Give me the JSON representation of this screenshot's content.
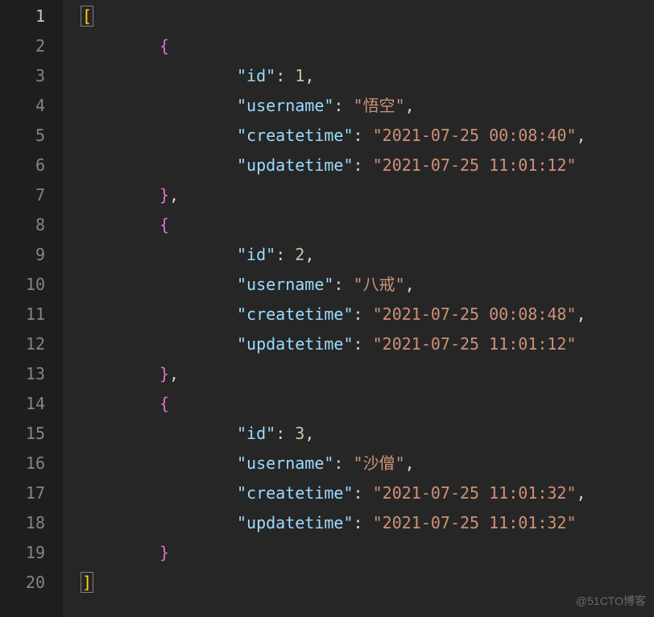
{
  "total_lines": 20,
  "active_line": 1,
  "watermark": "@51CTO博客",
  "json_content": [
    {
      "id": 1,
      "username": "悟空",
      "createtime": "2021-07-25 00:08:40",
      "updatetime": "2021-07-25 11:01:12"
    },
    {
      "id": 2,
      "username": "八戒",
      "createtime": "2021-07-25 00:08:48",
      "updatetime": "2021-07-25 11:01:12"
    },
    {
      "id": 3,
      "username": "沙僧",
      "createtime": "2021-07-25 11:01:32",
      "updatetime": "2021-07-25 11:01:32"
    }
  ],
  "tokens": {
    "open_bracket": "[",
    "close_bracket": "]",
    "open_brace": "{",
    "close_brace": "}",
    "comma": ",",
    "colon": ": ",
    "quote": "\"",
    "keys": {
      "id": "id",
      "username": "username",
      "createtime": "createtime",
      "updatetime": "updatetime"
    },
    "values": {
      "r0_id": "1",
      "r0_username": "悟空",
      "r0_createtime": "2021-07-25 00:08:40",
      "r0_updatetime": "2021-07-25 11:01:12",
      "r1_id": "2",
      "r1_username": "八戒",
      "r1_createtime": "2021-07-25 00:08:48",
      "r1_updatetime": "2021-07-25 11:01:12",
      "r2_id": "3",
      "r2_username": "沙僧",
      "r2_createtime": "2021-07-25 11:01:32",
      "r2_updatetime": "2021-07-25 11:01:32"
    }
  }
}
